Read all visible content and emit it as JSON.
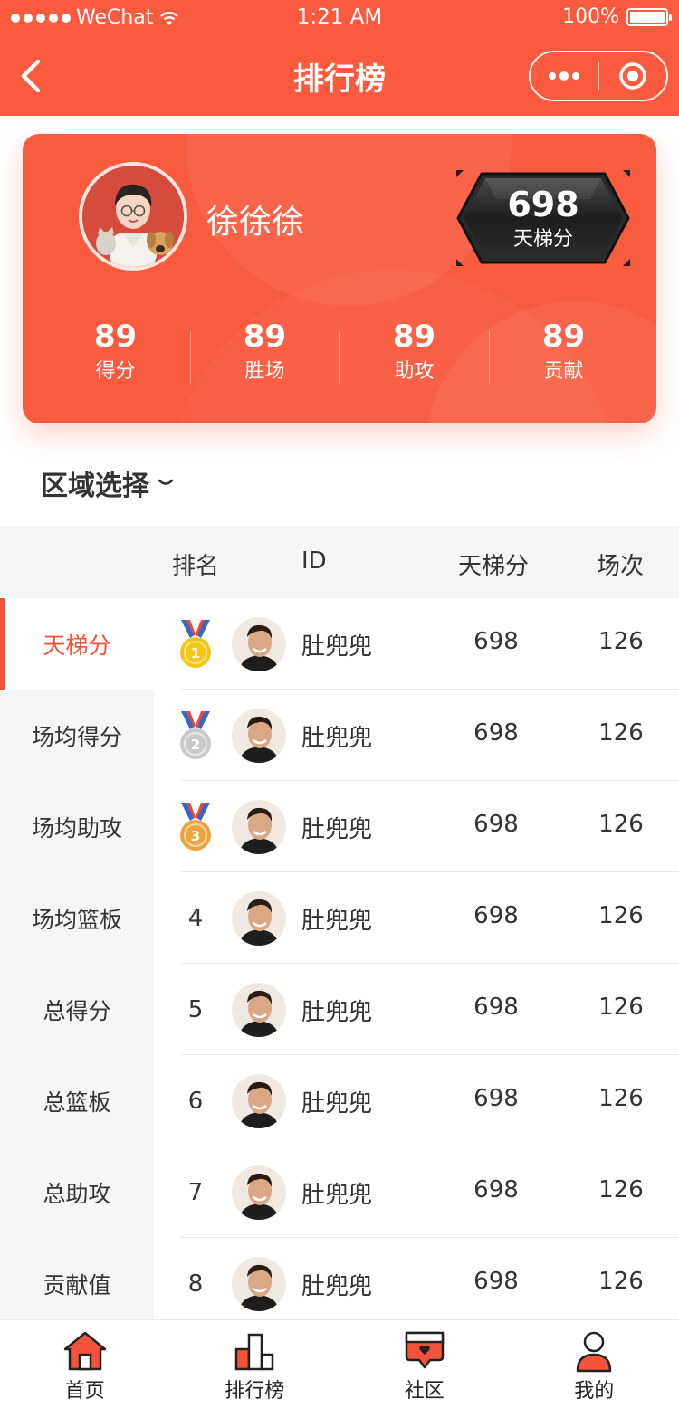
{
  "status_bar": {
    "carrier": "WeChat",
    "time": "1:21 AM",
    "battery": "100%"
  },
  "nav": {
    "title": "排行榜"
  },
  "profile": {
    "name": "徐徐徐",
    "ladder_score": "698",
    "ladder_label": "天梯分",
    "stats": [
      {
        "value": "89",
        "label": "得分"
      },
      {
        "value": "89",
        "label": "胜场"
      },
      {
        "value": "89",
        "label": "助攻"
      },
      {
        "value": "89",
        "label": "贡献"
      }
    ]
  },
  "region_selector": {
    "label": "区域选择"
  },
  "table": {
    "headers": {
      "rank": "排名",
      "id": "ID",
      "score": "天梯分",
      "games": "场次"
    },
    "rows": [
      {
        "rank": "1",
        "medal": "gold",
        "name": "肚兜兜",
        "score": "698",
        "games": "126"
      },
      {
        "rank": "2",
        "medal": "silver",
        "name": "肚兜兜",
        "score": "698",
        "games": "126"
      },
      {
        "rank": "3",
        "medal": "bronze",
        "name": "肚兜兜",
        "score": "698",
        "games": "126"
      },
      {
        "rank": "4",
        "name": "肚兜兜",
        "score": "698",
        "games": "126"
      },
      {
        "rank": "5",
        "name": "肚兜兜",
        "score": "698",
        "games": "126"
      },
      {
        "rank": "6",
        "name": "肚兜兜",
        "score": "698",
        "games": "126"
      },
      {
        "rank": "7",
        "name": "肚兜兜",
        "score": "698",
        "games": "126"
      },
      {
        "rank": "8",
        "name": "肚兜兜",
        "score": "698",
        "games": "126"
      }
    ]
  },
  "sidebar": {
    "active_index": 0,
    "items": [
      "天梯分",
      "场均得分",
      "场均助攻",
      "场均篮板",
      "总得分",
      "总篮板",
      "总助攻",
      "贡献值"
    ]
  },
  "tabbar": {
    "items": [
      {
        "label": "首页",
        "icon": "home-icon"
      },
      {
        "label": "排行榜",
        "icon": "ranking-icon"
      },
      {
        "label": "社区",
        "icon": "community-icon"
      },
      {
        "label": "我的",
        "icon": "profile-icon"
      }
    ]
  },
  "colors": {
    "brand": "#fa5a3e",
    "accent_text": "#f2533a",
    "gold": "#f5c518",
    "silver": "#c9c9c9",
    "bronze": "#eba53f"
  }
}
